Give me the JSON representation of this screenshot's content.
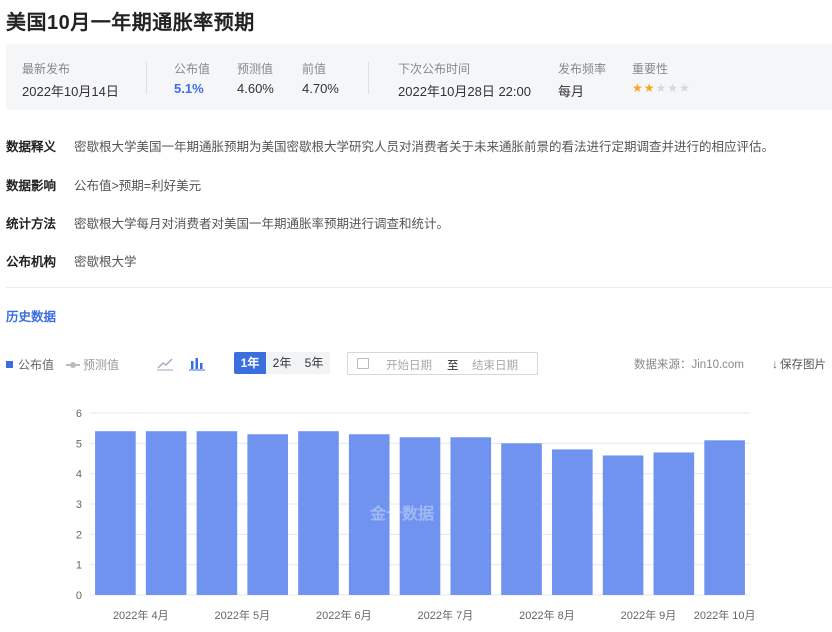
{
  "page": {
    "title": "美国10月一年期通胀率预期"
  },
  "summary": {
    "latest_label": "最新发布",
    "latest_value": "2022年10月14日",
    "actual_label": "公布值",
    "actual_value": "5.1%",
    "forecast_label": "预测值",
    "forecast_value": "4.60%",
    "previous_label": "前值",
    "previous_value": "4.70%",
    "next_label": "下次公布时间",
    "next_value": "2022年10月28日 22:00",
    "frequency_label": "发布频率",
    "frequency_value": "每月",
    "importance_label": "重要性",
    "importance_stars": 2,
    "importance_max": 5
  },
  "info": [
    {
      "key": "数据释义",
      "value": "密歇根大学美国一年期通胀预期为美国密歇根大学研究人员对消费者关于未来通胀前景的看法进行定期调查并进行的相应评估。"
    },
    {
      "key": "数据影响",
      "value": "公布值>预期=利好美元"
    },
    {
      "key": "统计方法",
      "value": "密歇根大学每月对消费者对美国一年期通胀率预期进行调查和统计。"
    },
    {
      "key": "公布机构",
      "value": "密歇根大学"
    }
  ],
  "history": {
    "title": "历史数据",
    "legend_actual": "公布值",
    "legend_forecast": "预测值",
    "range_1y": "1年",
    "range_2y": "2年",
    "range_5y": "5年",
    "date_start_placeholder": "开始日期",
    "date_separator": "至",
    "date_end_placeholder": "结束日期",
    "source": "数据来源：Jin10.com",
    "save_label": "保存图片",
    "watermark": "金十数据"
  },
  "colors": {
    "accent": "#3b6fe0",
    "bar": "#6f93ef",
    "grid": "#e6e8eb",
    "axis_text": "#666666"
  },
  "chart_data": {
    "type": "bar",
    "categories": [
      "2022年 4月a",
      "2022年 4月b",
      "2022年 5月a",
      "2022年 5月b",
      "2022年 6月a",
      "2022年 6月b",
      "2022年 7月a",
      "2022年 7月b",
      "2022年 8月a",
      "2022年 8月b",
      "2022年 9月a",
      "2022年 9月b",
      "2022年 10月a"
    ],
    "x_tick_labels": [
      "2022年 4月",
      "2022年 5月",
      "2022年 6月",
      "2022年 7月",
      "2022年 8月",
      "2022年 9月",
      "2022年 10月"
    ],
    "values": [
      5.4,
      5.4,
      5.4,
      5.3,
      5.4,
      5.3,
      5.2,
      5.2,
      5.0,
      4.8,
      4.6,
      4.7,
      5.1
    ],
    "y_ticks": [
      0,
      1,
      2,
      3,
      4,
      5,
      6
    ],
    "ylim": [
      0,
      6
    ],
    "grid": true,
    "legend": "top-left",
    "title": "",
    "xlabel": "",
    "ylabel": ""
  }
}
